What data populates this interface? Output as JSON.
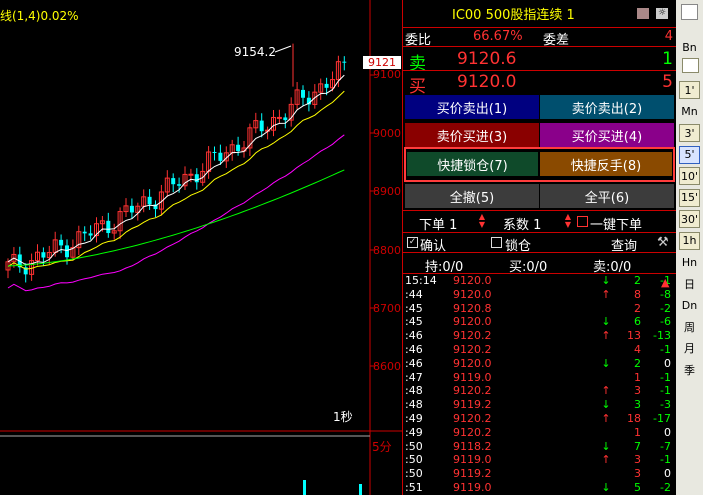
{
  "chart": {
    "indicator_text": "线(1,4)0.02%",
    "high_label": "9154.2",
    "last_price_tag": "9121",
    "price_axis": [
      "9100",
      "9000",
      "8900",
      "8800",
      "8700",
      "8600"
    ],
    "period_label": "1秒",
    "period_label2": "5分",
    "colors": {
      "up": "#ff3232",
      "down": "#00ffff",
      "ma5": "#ffffff",
      "ma10": "#ffff00",
      "ma20": "#ff00ff",
      "ma60": "#00ff00"
    }
  },
  "quote": {
    "title": "IC00  500股指连续  1",
    "ratio_label": "委比",
    "ratio_value": "66.67%",
    "diff_label": "委差",
    "diff_value": "4",
    "sell_label": "卖",
    "sell_price": "9120.6",
    "sell_qty": "1",
    "buy_label": "买",
    "buy_price": "9120.0",
    "buy_qty": "5"
  },
  "buttons": {
    "ask_sell": "买价卖出(1)",
    "bid_sell": "卖价卖出(2)",
    "ask_buy": "卖价买进(3)",
    "bid_buy": "买价买进(4)",
    "quick_lock": "快捷锁仓(7)",
    "quick_reverse": "快捷反手(8)",
    "cancel_all": "全撤(5)",
    "close_all": "全平(6)"
  },
  "order": {
    "qty_label": "下单 1",
    "factor_label": "系数 1",
    "one_click": "一键下单",
    "confirm": "确认",
    "lock": "锁仓",
    "query": "查询",
    "hold": "持:0/0",
    "buy_pos": "买:0/0",
    "sell_pos": "卖:0/0"
  },
  "ticks": [
    {
      "t": "15:14",
      "p": "9120.0",
      "a": "↓",
      "v": "2",
      "d": "-1"
    },
    {
      "t": ":44",
      "p": "9120.0",
      "a": "↑",
      "v": "8",
      "d": "-8"
    },
    {
      "t": ":45",
      "p": "9120.8",
      "a": "",
      "v": "2",
      "d": "-2"
    },
    {
      "t": ":45",
      "p": "9120.0",
      "a": "↓",
      "v": "6",
      "d": "-6"
    },
    {
      "t": ":46",
      "p": "9120.2",
      "a": "↑",
      "v": "13",
      "d": "-13"
    },
    {
      "t": ":46",
      "p": "9120.2",
      "a": "",
      "v": "4",
      "d": "-1"
    },
    {
      "t": ":46",
      "p": "9120.0",
      "a": "↓",
      "v": "2",
      "d": "0"
    },
    {
      "t": ":47",
      "p": "9119.0",
      "a": "",
      "v": "1",
      "d": "-1"
    },
    {
      "t": ":48",
      "p": "9120.2",
      "a": "↑",
      "v": "3",
      "d": "-1"
    },
    {
      "t": ":48",
      "p": "9119.2",
      "a": "↓",
      "v": "3",
      "d": "-3"
    },
    {
      "t": ":49",
      "p": "9120.2",
      "a": "↑",
      "v": "18",
      "d": "-17"
    },
    {
      "t": ":49",
      "p": "9120.2",
      "a": "",
      "v": "1",
      "d": "0"
    },
    {
      "t": ":50",
      "p": "9118.2",
      "a": "↓",
      "v": "7",
      "d": "-7"
    },
    {
      "t": ":50",
      "p": "9119.0",
      "a": "↑",
      "v": "3",
      "d": "-1"
    },
    {
      "t": ":50",
      "p": "9119.2",
      "a": "",
      "v": "3",
      "d": "0"
    },
    {
      "t": ":51",
      "p": "9119.0",
      "a": "↓",
      "v": "5",
      "d": "-2"
    }
  ],
  "toolbar": [
    "Bn",
    "Sn",
    "1'",
    "Mn",
    "3'",
    "5'",
    "10'",
    "15'",
    "30'",
    "1h",
    "Hn",
    "日",
    "Dn",
    "周",
    "月",
    "季"
  ]
}
